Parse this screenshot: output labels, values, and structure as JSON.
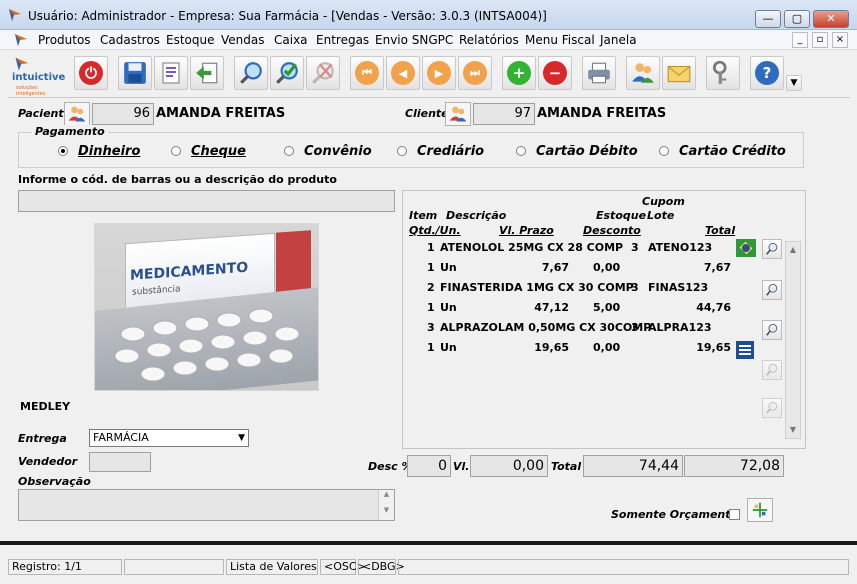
{
  "window": {
    "title": "Usuário: Administrador - Empresa: Sua Farmácia - [Vendas - Versão: 3.0.3 (INTSA004)]",
    "btn_min": "—",
    "btn_max": "▢",
    "btn_close": "✕"
  },
  "menu": [
    "Produtos",
    "Cadastros",
    "Estoque",
    "Vendas",
    "Caixa",
    "Entregas",
    "Envio SNGPC",
    "Relatórios",
    "Menu Fiscal",
    "Janela"
  ],
  "mdi": {
    "min": "_",
    "restore": "▫",
    "close": "×"
  },
  "toolbar": {
    "logo_text": "intuictive",
    "logo_sub": "soluções inteligentes"
  },
  "paciente": {
    "label": "Paciente",
    "code": "96",
    "name": "AMANDA FREITAS"
  },
  "cliente": {
    "label": "Cliente",
    "code": "97",
    "name": "AMANDA FREITAS"
  },
  "pagamento": {
    "legend": "Pagamento",
    "options": [
      {
        "label": "Dinheiro",
        "selected": true
      },
      {
        "label": "Cheque",
        "selected": false
      },
      {
        "label": "Convênio",
        "selected": false
      },
      {
        "label": "Crediário",
        "selected": false
      },
      {
        "label": "Cartão Débito",
        "selected": false
      },
      {
        "label": "Cartão Crédito",
        "selected": false
      }
    ]
  },
  "search": {
    "label": "Informe o cód. de barras ou a descrição do produto",
    "value": ""
  },
  "product_image": {
    "title": "MEDICAMENTO",
    "sub": "substância"
  },
  "manufacturer": "MEDLEY",
  "grid": {
    "headers": {
      "cupom": "Cupom",
      "item": "Item",
      "descricao": "Descrição",
      "estoque": "Estoque",
      "lote": "Lote",
      "qtd": "Qtd./Un.",
      "vl_prazo": "Vl. Prazo",
      "desconto": "Desconto",
      "total": "Total"
    },
    "rows": [
      {
        "item": "1",
        "desc": "ATENOLOL 25MG CX 28 COMP",
        "estoque": "3",
        "lote": "ATENO123",
        "qtd": "1",
        "un": "Un",
        "vl_prazo": "7,67",
        "desconto": "0,00",
        "total": "7,67"
      },
      {
        "item": "2",
        "desc": "FINASTERIDA 1MG CX 30 COMP",
        "estoque": "3",
        "lote": "FINAS123",
        "qtd": "1",
        "un": "Un",
        "vl_prazo": "47,12",
        "desconto": "5,00",
        "total": "44,76"
      },
      {
        "item": "3",
        "desc": "ALPRAZOLAM 0,50MG CX 30COMP",
        "estoque": "3",
        "lote": "ALPRA123",
        "qtd": "1",
        "un": "Un",
        "vl_prazo": "19,65",
        "desconto": "0,00",
        "total": "19,65"
      }
    ]
  },
  "entrega": {
    "label": "Entrega",
    "value": "FARMÁCIA"
  },
  "vendedor": {
    "label": "Vendedor",
    "value": ""
  },
  "observacao": {
    "label": "Observação",
    "value": ""
  },
  "totals": {
    "desc_label": "Desc %",
    "desc_value": "0",
    "vl_label": "Vl.",
    "vl_value": "0,00",
    "total_label": "Total",
    "total_value": "74,44",
    "final_value": "72,08"
  },
  "orcamento": {
    "label": "Somente Orçamento"
  },
  "status": {
    "registro": "Registro: 1/1",
    "empty": "",
    "lista": "Lista de Valores",
    "osc": "<OSC>",
    "dbg": "<DBG>"
  }
}
